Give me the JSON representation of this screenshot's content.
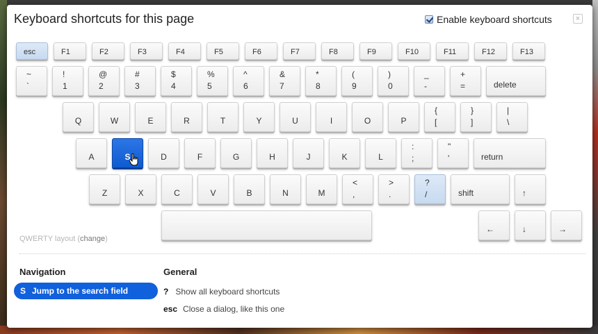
{
  "dialog": {
    "title": "Keyboard shortcuts for this page",
    "enable_label": "Enable keyboard shortcuts",
    "enable_checked": true,
    "close_label": "×"
  },
  "keyboard": {
    "function_row": [
      "esc",
      "F1",
      "F2",
      "F3",
      "F4",
      "F5",
      "F6",
      "F7",
      "F8",
      "F9",
      "F10",
      "F11",
      "F12",
      "F13"
    ],
    "number_row": [
      {
        "top": "~",
        "bottom": "`"
      },
      {
        "top": "!",
        "bottom": "1"
      },
      {
        "top": "@",
        "bottom": "2"
      },
      {
        "top": "#",
        "bottom": "3"
      },
      {
        "top": "$",
        "bottom": "4"
      },
      {
        "top": "%",
        "bottom": "5"
      },
      {
        "top": "^",
        "bottom": "6"
      },
      {
        "top": "&",
        "bottom": "7"
      },
      {
        "top": "*",
        "bottom": "8"
      },
      {
        "top": "(",
        "bottom": "9"
      },
      {
        "top": ")",
        "bottom": "0"
      },
      {
        "top": "_",
        "bottom": "-"
      },
      {
        "top": "+",
        "bottom": "="
      }
    ],
    "delete_label": "delete",
    "qwerty_row": [
      "Q",
      "W",
      "E",
      "R",
      "T",
      "Y",
      "U",
      "I",
      "O",
      "P"
    ],
    "qwerty_row_extra": [
      {
        "top": "{",
        "bottom": "["
      },
      {
        "top": "}",
        "bottom": "]"
      },
      {
        "top": "|",
        "bottom": "\\"
      }
    ],
    "home_row": [
      "A",
      "S",
      "D",
      "F",
      "G",
      "H",
      "J",
      "K",
      "L"
    ],
    "home_row_extra": [
      {
        "top": ":",
        "bottom": ";"
      },
      {
        "top": "\"",
        "bottom": "'"
      }
    ],
    "return_label": "return",
    "bottom_row": [
      "Z",
      "X",
      "C",
      "V",
      "B",
      "N",
      "M"
    ],
    "bottom_row_extra": [
      {
        "top": "<",
        "bottom": ","
      },
      {
        "top": ">",
        "bottom": "."
      },
      {
        "top": "?",
        "bottom": "/"
      }
    ],
    "shift_label": "shift",
    "arrows": {
      "up": "↑",
      "left": "←",
      "down": "↓",
      "right": "→"
    },
    "selected_key": "S",
    "highlighted_keys": [
      "esc",
      "/"
    ]
  },
  "layout_note": {
    "prefix": "QWERTY layout (",
    "change_link": "change",
    "suffix": ")"
  },
  "navigation": {
    "heading": "Navigation",
    "items": [
      {
        "key": "S",
        "description": "Jump to the search field",
        "selected": true
      }
    ]
  },
  "general": {
    "heading": "General",
    "items": [
      {
        "key": "?",
        "description": "Show all keyboard shortcuts"
      },
      {
        "key": "esc",
        "description": "Close a dialog, like this one"
      }
    ]
  }
}
